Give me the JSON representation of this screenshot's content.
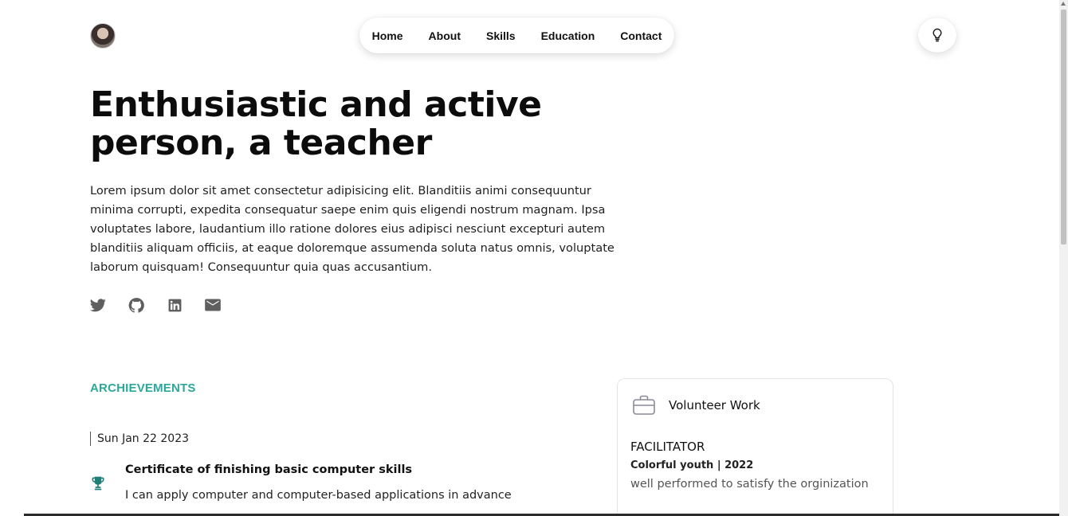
{
  "header": {
    "nav": [
      "Home",
      "About",
      "Skills",
      "Education",
      "Contact"
    ]
  },
  "hero": {
    "title": "Enthusiastic and active person, a teacher",
    "text": "Lorem ipsum dolor sit amet consectetur adipisicing elit. Blanditiis animi consequuntur minima corrupti, expedita consequatur saepe enim quis eligendi nostrum magnam. Ipsa voluptates labore, laudantium illo ratione dolores eius adipisci nesciunt excepturi autem blanditiis aliquam officiis, at eaque doloremque assumenda soluta natus omnis, voluptate laborum quisquam! Consequuntur quia quas accusantium."
  },
  "socials": [
    "twitter-icon",
    "github-icon",
    "linkedin-icon",
    "mail-icon"
  ],
  "achievements": {
    "heading": "ARCHIEVEMENTS",
    "date": "Sun Jan 22 2023",
    "title": "Certificate of finishing basic computer skills",
    "description": "I can apply computer and computer-based applications in advance"
  },
  "volunteer": {
    "heading": "Volunteer Work",
    "role": "FACILITATOR",
    "org": "Colorful youth | 2022",
    "description": "well performed to satisfy the orginization"
  },
  "colors": {
    "accent": "#2aa99a",
    "text": "#111111",
    "icon": "#555555"
  }
}
